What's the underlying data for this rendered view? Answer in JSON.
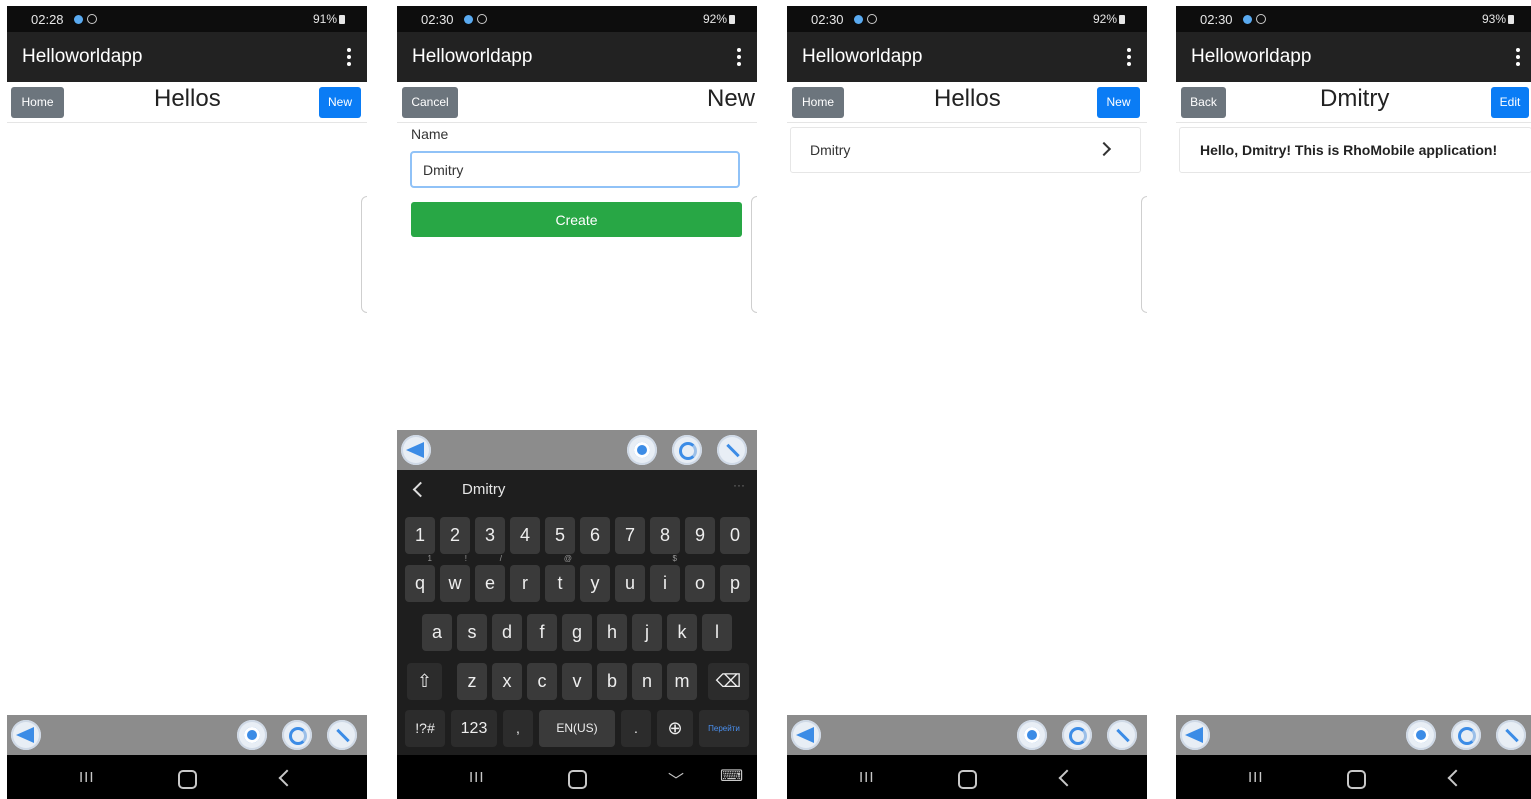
{
  "app_title": "Helloworldapp",
  "screens": [
    {
      "status": {
        "time": "02:28",
        "signal": "91%"
      },
      "left_button": "Home",
      "title": "Hellos",
      "right_button": "New"
    },
    {
      "status": {
        "time": "02:30",
        "signal": "92%"
      },
      "left_button": "Cancel",
      "title": "New",
      "form": {
        "name_label": "Name",
        "name_value": "Dmitry",
        "create_label": "Create"
      },
      "keyboard": {
        "suggestion": "Dmitry",
        "more": "···",
        "numbers": [
          "1",
          "2",
          "3",
          "4",
          "5",
          "6",
          "7",
          "8",
          "9",
          "0"
        ],
        "row1": [
          "q",
          "w",
          "e",
          "r",
          "t",
          "y",
          "u",
          "i",
          "o",
          "p"
        ],
        "row1_hints": [
          "1",
          "!",
          "/",
          "",
          "@",
          "",
          "",
          "$",
          "",
          ""
        ],
        "row2": [
          "a",
          "s",
          "d",
          "f",
          "g",
          "h",
          "j",
          "k",
          "l"
        ],
        "row3": [
          "z",
          "x",
          "c",
          "v",
          "b",
          "n",
          "m"
        ],
        "shift": "⇧",
        "backspace": "⌫",
        "symbols": "!?#",
        "num_mode": "123",
        "comma": ",",
        "space": "EN(US)",
        "period": ".",
        "globe": "⊕",
        "go": "Перейти",
        "nav_down": "﹀",
        "nav_kb": "⌨"
      }
    },
    {
      "status": {
        "time": "02:30",
        "signal": "92%"
      },
      "left_button": "Home",
      "title": "Hellos",
      "right_button": "New",
      "list": [
        {
          "name": "Dmitry"
        }
      ]
    },
    {
      "status": {
        "time": "02:30",
        "signal": "93%"
      },
      "left_button": "Back",
      "title": "Dmitry",
      "right_button": "Edit",
      "greeting": "Hello, Dmitry! This is RhoMobile application!"
    }
  ],
  "nav": {
    "recent": "III"
  },
  "colors": {
    "primary_blue": "#0a7cf5",
    "secondary_gray": "#6c757d",
    "success_green": "#28a745",
    "appbar": "#222222"
  }
}
